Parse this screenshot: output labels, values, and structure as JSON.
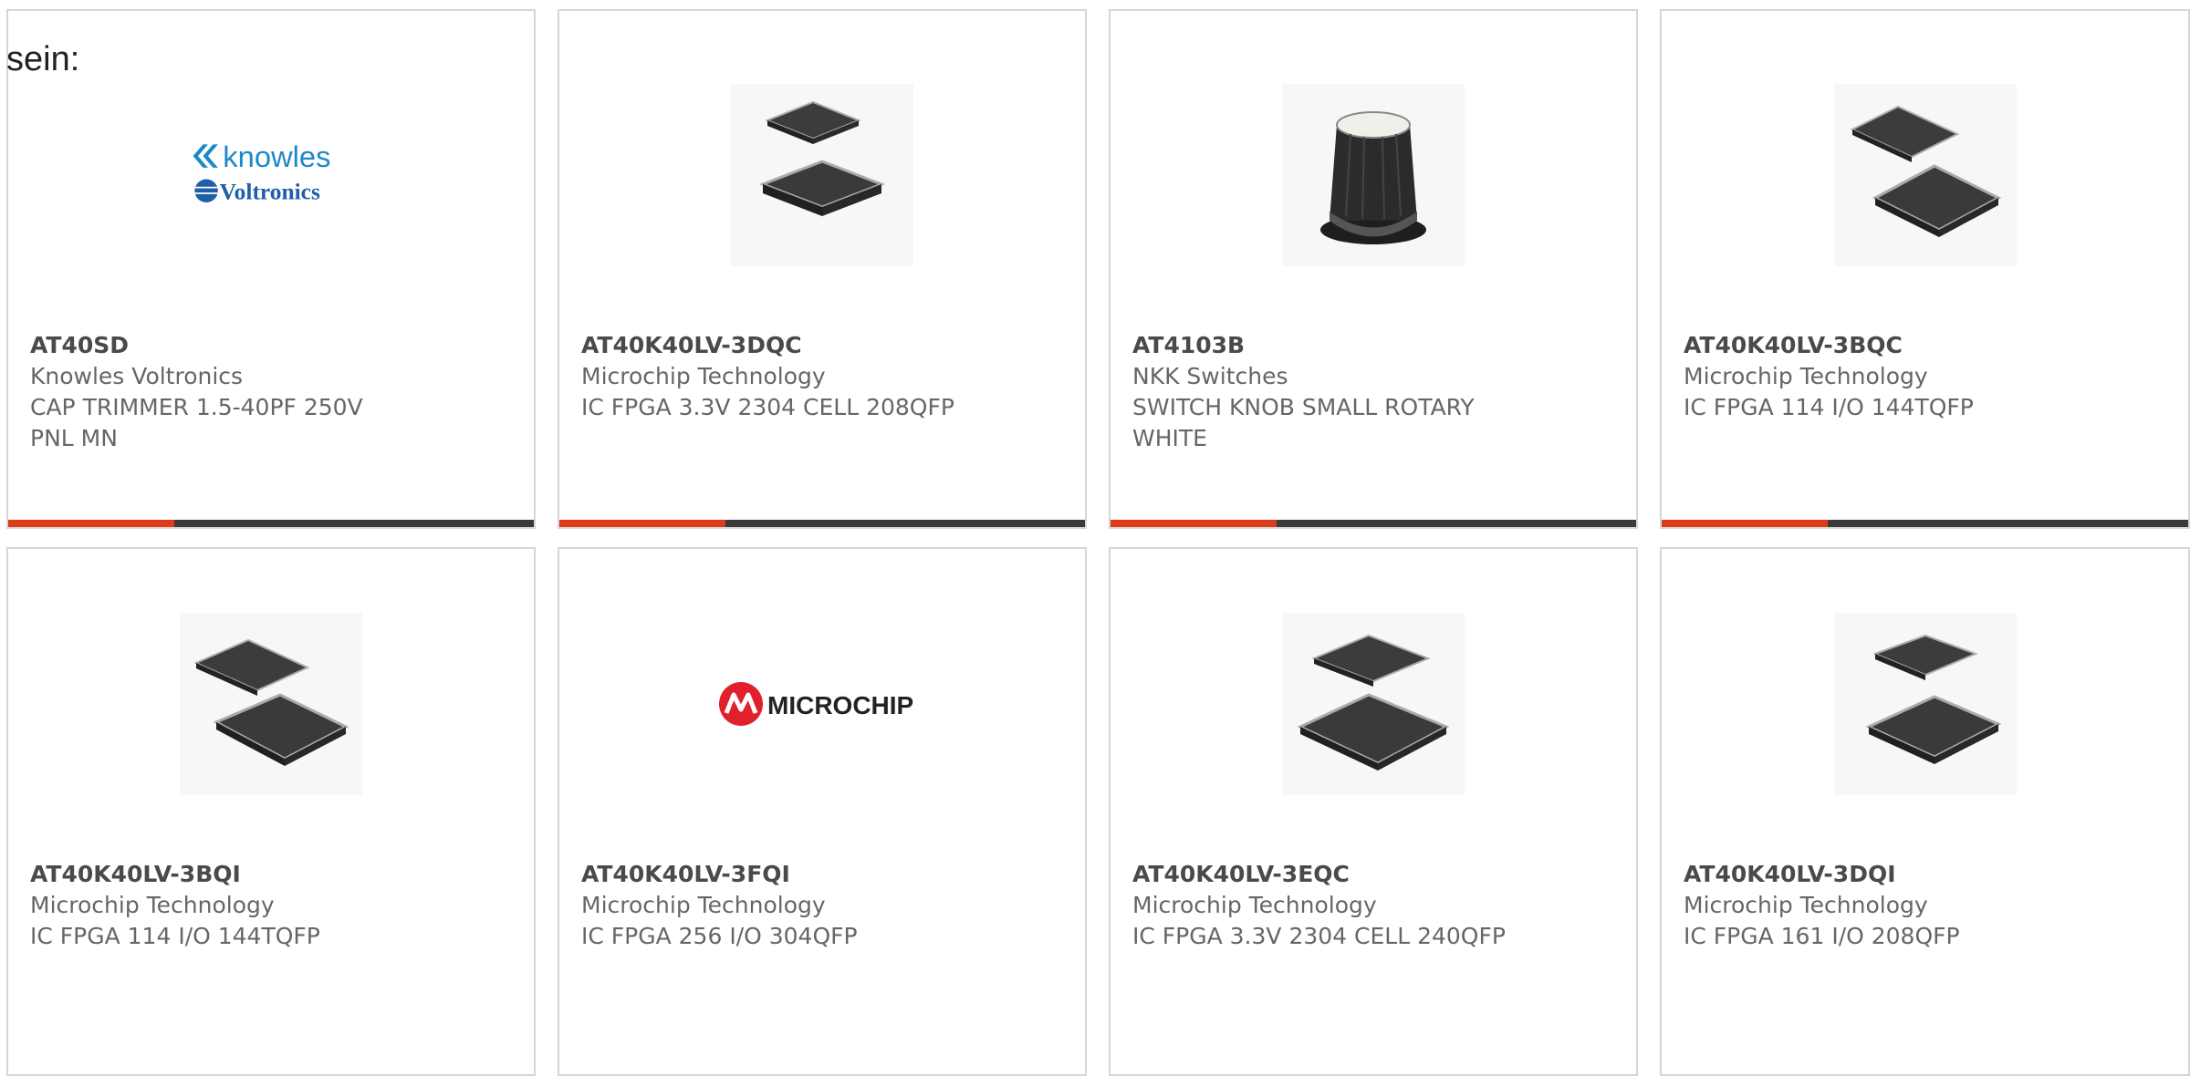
{
  "intro_text": "sein:",
  "products": [
    {
      "part": "AT40SD",
      "manufacturer": "Knowles Voltronics",
      "description": "CAP TRIMMER 1.5-40PF 250V PNL MN",
      "image": "knowles-voltronics-logo"
    },
    {
      "part": "AT40K40LV-3DQC",
      "manufacturer": "Microchip Technology",
      "description": "IC FPGA 3.3V 2304 CELL 208QFP",
      "image": "qfp-chip-photo"
    },
    {
      "part": "AT4103B",
      "manufacturer": "NKK Switches",
      "description": "SWITCH KNOB SMALL ROTARY WHITE",
      "image": "rotary-knob-photo"
    },
    {
      "part": "AT40K40LV-3BQC",
      "manufacturer": "Microchip Technology",
      "description": "IC FPGA 114 I/O 144TQFP",
      "image": "qfp-chip-photo"
    },
    {
      "part": "AT40K40LV-3BQI",
      "manufacturer": "Microchip Technology",
      "description": "IC FPGA 114 I/O 144TQFP",
      "image": "qfp-chip-photo"
    },
    {
      "part": "AT40K40LV-3FQI",
      "manufacturer": "Microchip Technology",
      "description": "IC FPGA 256 I/O 304QFP",
      "image": "microchip-logo"
    },
    {
      "part": "AT40K40LV-3EQC",
      "manufacturer": "Microchip Technology",
      "description": "IC FPGA 3.3V 2304 CELL 240QFP",
      "image": "qfp-chip-photo"
    },
    {
      "part": "AT40K40LV-3DQI",
      "manufacturer": "Microchip Technology",
      "description": "IC FPGA 161 I/O 208QFP",
      "image": "qfp-chip-photo"
    }
  ],
  "logos": {
    "knowles_wordmark": "knowles",
    "voltronics_wordmark": "Voltronics",
    "microchip_wordmark": "MICROCHIP"
  },
  "colors": {
    "accent": "#dd3b17",
    "bar": "#3a3a3a",
    "knowles_blue": "#1e88c8"
  }
}
